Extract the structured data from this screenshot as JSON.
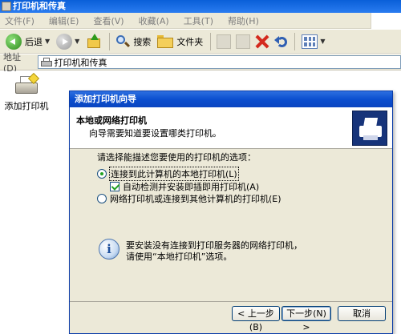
{
  "explorer": {
    "title": "打印机和传真",
    "menu": [
      "文件(F)",
      "编辑(E)",
      "查看(V)",
      "收藏(A)",
      "工具(T)",
      "帮助(H)"
    ],
    "toolbar": {
      "back_label": "后退",
      "search_label": "搜索",
      "folders_label": "文件夹"
    },
    "address": {
      "label": "地址(D)",
      "value": "打印机和传真"
    },
    "items": [
      {
        "label": "添加打印机",
        "icon": "add-printer-icon"
      }
    ]
  },
  "wizard": {
    "title": "添加打印机向导",
    "header_title": "本地或网络打印机",
    "header_subtitle": "向导需要知道要设置哪类打印机。",
    "prompt": "请选择能描述您要使用的打印机的选项：",
    "options": [
      {
        "label": "连接到此计算机的本地打印机(L)",
        "selected": true
      },
      {
        "label": "网络打印机或连接到其他计算机的打印机(E)",
        "selected": false
      }
    ],
    "auto_detect": {
      "label": "自动检测并安装即插即用打印机(A)",
      "checked": true
    },
    "info_line1": "要安装没有连接到打印服务器的网络打印机，",
    "info_line2": "请使用“本地打印机”选项。",
    "buttons": {
      "back": "< 上一步(B)",
      "next": "下一步(N) >",
      "cancel": "取消"
    }
  },
  "colors": {
    "title_bar": "#0a4fcf",
    "dialog_bg": "#ece9d8",
    "header_icon_bg": "#17347a"
  }
}
